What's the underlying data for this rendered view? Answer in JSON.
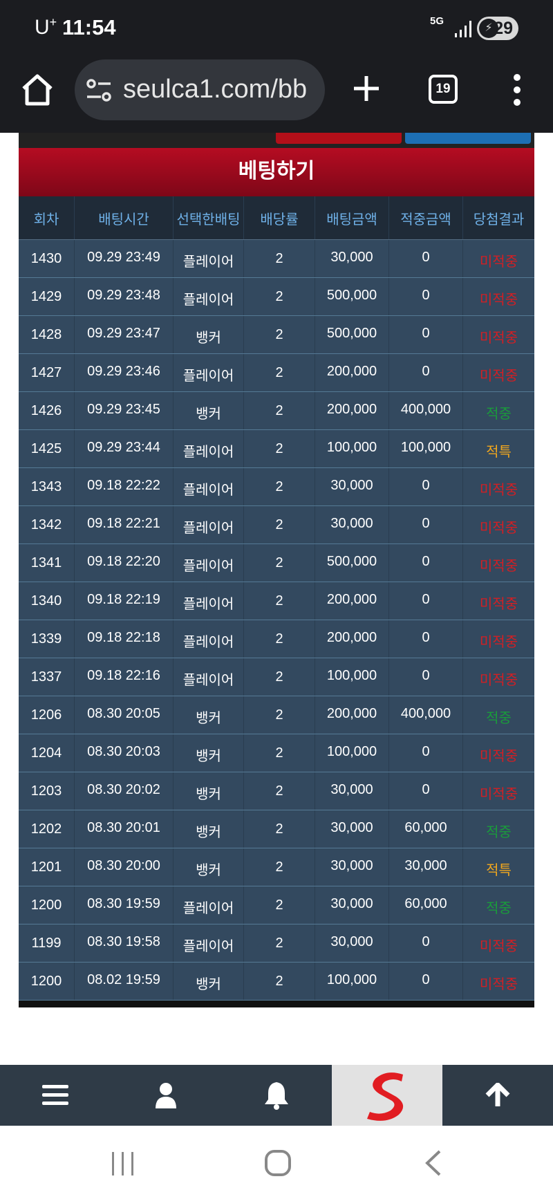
{
  "status_bar": {
    "carrier": "U",
    "carrier_sup": "+",
    "time": "11:54",
    "network": "5G",
    "battery": "29"
  },
  "browser": {
    "url": "seulca1.com/bb",
    "tab_count": "19"
  },
  "betting": {
    "title": "베팅하기",
    "columns": [
      "회차",
      "배팅시간",
      "선택한배팅",
      "배당률",
      "배팅금액",
      "적중금액",
      "당첨결과"
    ],
    "rows": [
      [
        "1430",
        "09.29 23:49",
        "플레이어",
        "2",
        "30,000",
        "0",
        "미적중"
      ],
      [
        "1429",
        "09.29 23:48",
        "플레이어",
        "2",
        "500,000",
        "0",
        "미적중"
      ],
      [
        "1428",
        "09.29 23:47",
        "뱅커",
        "2",
        "500,000",
        "0",
        "미적중"
      ],
      [
        "1427",
        "09.29 23:46",
        "플레이어",
        "2",
        "200,000",
        "0",
        "미적중"
      ],
      [
        "1426",
        "09.29 23:45",
        "뱅커",
        "2",
        "200,000",
        "400,000",
        "적중"
      ],
      [
        "1425",
        "09.29 23:44",
        "플레이어",
        "2",
        "100,000",
        "100,000",
        "적특"
      ],
      [
        "1343",
        "09.18 22:22",
        "플레이어",
        "2",
        "30,000",
        "0",
        "미적중"
      ],
      [
        "1342",
        "09.18 22:21",
        "플레이어",
        "2",
        "30,000",
        "0",
        "미적중"
      ],
      [
        "1341",
        "09.18 22:20",
        "플레이어",
        "2",
        "500,000",
        "0",
        "미적중"
      ],
      [
        "1340",
        "09.18 22:19",
        "플레이어",
        "2",
        "200,000",
        "0",
        "미적중"
      ],
      [
        "1339",
        "09.18 22:18",
        "플레이어",
        "2",
        "200,000",
        "0",
        "미적중"
      ],
      [
        "1337",
        "09.18 22:16",
        "플레이어",
        "2",
        "100,000",
        "0",
        "미적중"
      ],
      [
        "1206",
        "08.30 20:05",
        "뱅커",
        "2",
        "200,000",
        "400,000",
        "적중"
      ],
      [
        "1204",
        "08.30 20:03",
        "뱅커",
        "2",
        "100,000",
        "0",
        "미적중"
      ],
      [
        "1203",
        "08.30 20:02",
        "뱅커",
        "2",
        "30,000",
        "0",
        "미적중"
      ],
      [
        "1202",
        "08.30 20:01",
        "뱅커",
        "2",
        "30,000",
        "60,000",
        "적중"
      ],
      [
        "1201",
        "08.30 20:00",
        "뱅커",
        "2",
        "30,000",
        "30,000",
        "적특"
      ],
      [
        "1200",
        "08.30 19:59",
        "플레이어",
        "2",
        "30,000",
        "60,000",
        "적중"
      ],
      [
        "1199",
        "08.30 19:58",
        "플레이어",
        "2",
        "30,000",
        "0",
        "미적중"
      ],
      [
        "1200",
        "08.02 19:59",
        "뱅커",
        "2",
        "100,000",
        "0",
        "미적중"
      ]
    ],
    "result_colors": {
      "미적중": "#d21f24",
      "적중": "#1a9b3b",
      "적특": "#f0a61e"
    }
  },
  "bottom_nav": {
    "items": [
      "menu-icon",
      "user-icon",
      "bell-icon",
      "site-logo",
      "arrow-up-icon"
    ],
    "logo_letter": "S"
  },
  "colors": {
    "header_red": "#b50c22",
    "row_bg": "#33495f",
    "column_header_text": "#6fb1e8"
  }
}
